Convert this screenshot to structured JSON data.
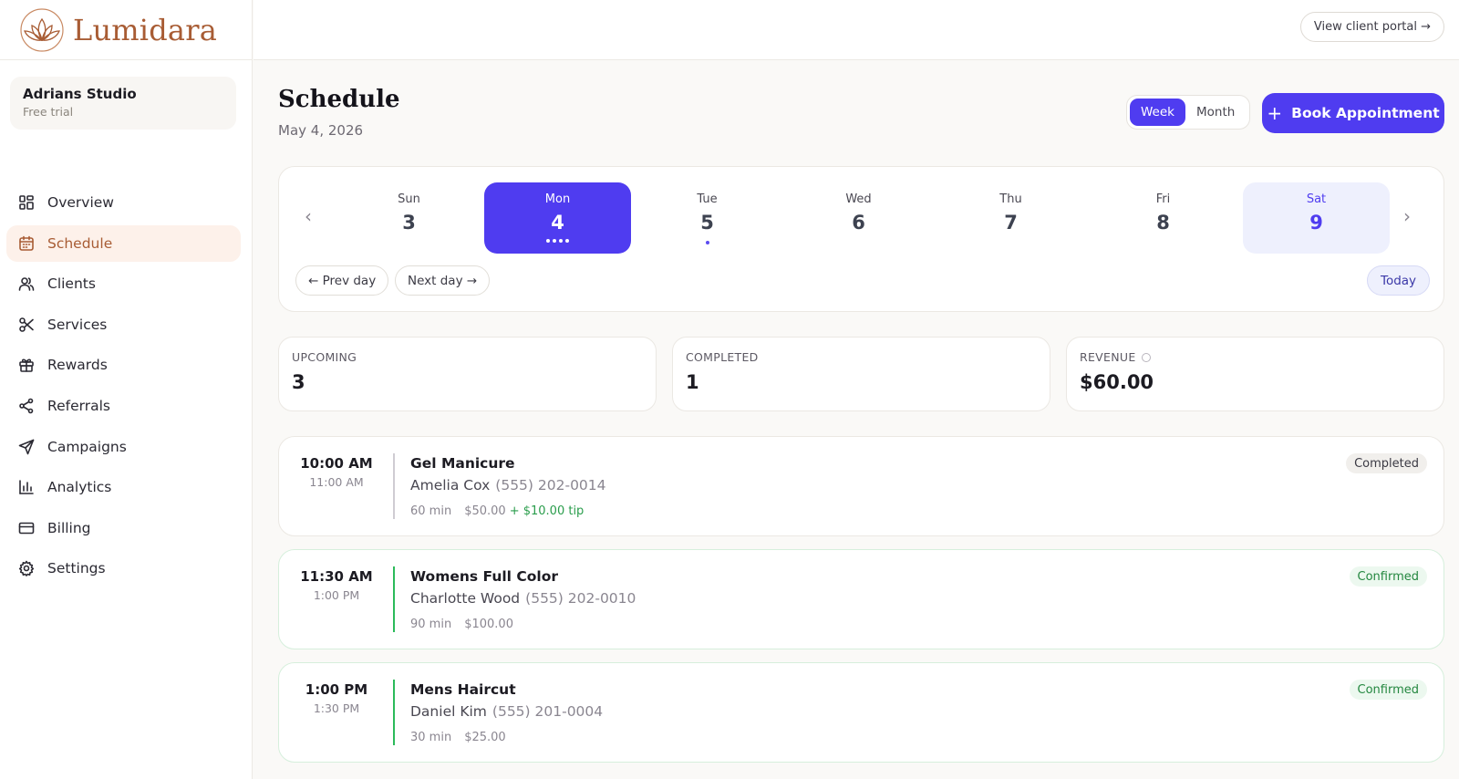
{
  "brand": {
    "name": "Lumidara"
  },
  "studio": {
    "name": "Adrians Studio",
    "plan": "Free trial"
  },
  "nav": [
    {
      "label": "Overview",
      "icon": "grid-icon"
    },
    {
      "label": "Schedule",
      "icon": "calendar-icon",
      "active": true
    },
    {
      "label": "Clients",
      "icon": "users-icon"
    },
    {
      "label": "Services",
      "icon": "scissors-icon"
    },
    {
      "label": "Rewards",
      "icon": "gift-icon"
    },
    {
      "label": "Referrals",
      "icon": "share-icon"
    },
    {
      "label": "Campaigns",
      "icon": "send-icon"
    },
    {
      "label": "Analytics",
      "icon": "bar-chart-icon"
    },
    {
      "label": "Billing",
      "icon": "credit-card-icon"
    },
    {
      "label": "Settings",
      "icon": "gear-icon"
    }
  ],
  "topbar": {
    "portal_label": "View client portal →"
  },
  "header": {
    "title": "Schedule",
    "date": "May 4, 2026",
    "view_week": "Week",
    "view_month": "Month",
    "active_view": "Week",
    "book_label": "Book Appointment",
    "book_icon": "+"
  },
  "week": {
    "prev_arrow": "‹",
    "next_arrow": "›",
    "days": [
      {
        "dow": "Sun",
        "num": "3"
      },
      {
        "dow": "Mon",
        "num": "4",
        "selected": true,
        "appointment_dots": 4
      },
      {
        "dow": "Tue",
        "num": "5",
        "appointment_dots": 1
      },
      {
        "dow": "Wed",
        "num": "6"
      },
      {
        "dow": "Thu",
        "num": "7"
      },
      {
        "dow": "Fri",
        "num": "8"
      },
      {
        "dow": "Sat",
        "num": "9",
        "highlighted": true
      }
    ],
    "prev_day": "← Prev day",
    "next_day": "Next day →",
    "today": "Today"
  },
  "stats": {
    "upcoming": {
      "label": "UPCOMING",
      "value": "3"
    },
    "completed": {
      "label": "COMPLETED",
      "value": "1"
    },
    "revenue": {
      "label": "REVENUE",
      "value": "$60.00"
    }
  },
  "appointments": [
    {
      "start": "10:00 AM",
      "end": "11:00 AM",
      "service": "Gel Manicure",
      "client": "Amelia Cox",
      "phone": "(555) 202-0014",
      "duration": "60 min",
      "price": "$50.00",
      "tip": "+ $10.00 tip",
      "status": "Completed"
    },
    {
      "start": "11:30 AM",
      "end": "1:00 PM",
      "service": "Womens Full Color",
      "client": "Charlotte Wood",
      "phone": "(555) 202-0010",
      "duration": "90 min",
      "price": "$100.00",
      "status": "Confirmed"
    },
    {
      "start": "1:00 PM",
      "end": "1:30 PM",
      "service": "Mens Haircut",
      "client": "Daniel Kim",
      "phone": "(555) 201-0004",
      "duration": "30 min",
      "price": "$25.00",
      "status": "Confirmed"
    }
  ],
  "colors": {
    "brand": "#a85c34",
    "accent": "#4f3cf0",
    "confirmed": "#23873f"
  }
}
